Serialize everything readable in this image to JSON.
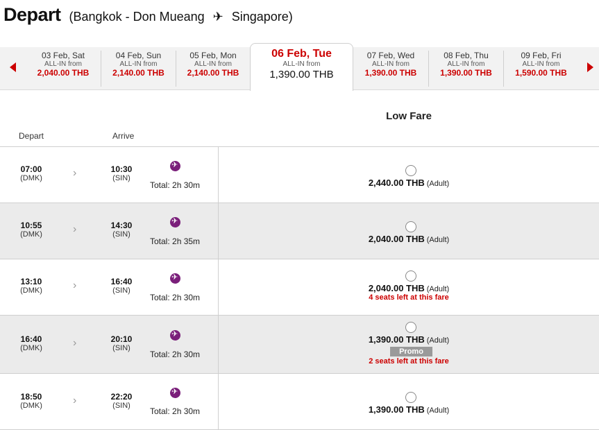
{
  "header": {
    "title": "Depart",
    "origin": "(Bangkok - Don Mueang",
    "plane_icon": "plane-icon",
    "destination": "Singapore)"
  },
  "date_bar": {
    "tabs": [
      {
        "date": "03 Feb, Sat",
        "label": "ALL-IN from",
        "price": "2,040.00 THB"
      },
      {
        "date": "04 Feb, Sun",
        "label": "ALL-IN from",
        "price": "2,140.00 THB"
      },
      {
        "date": "05 Feb, Mon",
        "label": "ALL-IN from",
        "price": "2,140.00 THB"
      },
      {
        "date": "06 Feb, Tue",
        "label": "ALL-IN from",
        "price": "1,390.00 THB",
        "selected": true
      },
      {
        "date": "07 Feb, Wed",
        "label": "ALL-IN from",
        "price": "1,390.00 THB"
      },
      {
        "date": "08 Feb, Thu",
        "label": "ALL-IN from",
        "price": "1,390.00 THB"
      },
      {
        "date": "09 Feb, Fri",
        "label": "ALL-IN from",
        "price": "1,590.00 THB"
      }
    ]
  },
  "table": {
    "fare_header": "Low Fare",
    "col_depart": "Depart",
    "col_arrive": "Arrive"
  },
  "flights": [
    {
      "dep_time": "07:00",
      "dep_code": "(DMK)",
      "arr_time": "10:30",
      "arr_code": "(SIN)",
      "total": "Total: 2h 30m",
      "price": "2,440.00 THB",
      "pax": "(Adult)"
    },
    {
      "dep_time": "10:55",
      "dep_code": "(DMK)",
      "arr_time": "14:30",
      "arr_code": "(SIN)",
      "total": "Total: 2h 35m",
      "price": "2,040.00 THB",
      "pax": "(Adult)"
    },
    {
      "dep_time": "13:10",
      "dep_code": "(DMK)",
      "arr_time": "16:40",
      "arr_code": "(SIN)",
      "total": "Total: 2h 30m",
      "price": "2,040.00 THB",
      "pax": "(Adult)",
      "seats": "4 seats left at this fare"
    },
    {
      "dep_time": "16:40",
      "dep_code": "(DMK)",
      "arr_time": "20:10",
      "arr_code": "(SIN)",
      "total": "Total: 2h 30m",
      "price": "1,390.00 THB",
      "pax": "(Adult)",
      "promo": "Promo",
      "seats": "2 seats left at this fare"
    },
    {
      "dep_time": "18:50",
      "dep_code": "(DMK)",
      "arr_time": "22:20",
      "arr_code": "(SIN)",
      "total": "Total: 2h 30m",
      "price": "1,390.00 THB",
      "pax": "(Adult)"
    }
  ],
  "colors": {
    "accent_red": "#cc0000",
    "icon_purple": "#7a1f7a",
    "promo_grey": "#9a9a9a"
  }
}
